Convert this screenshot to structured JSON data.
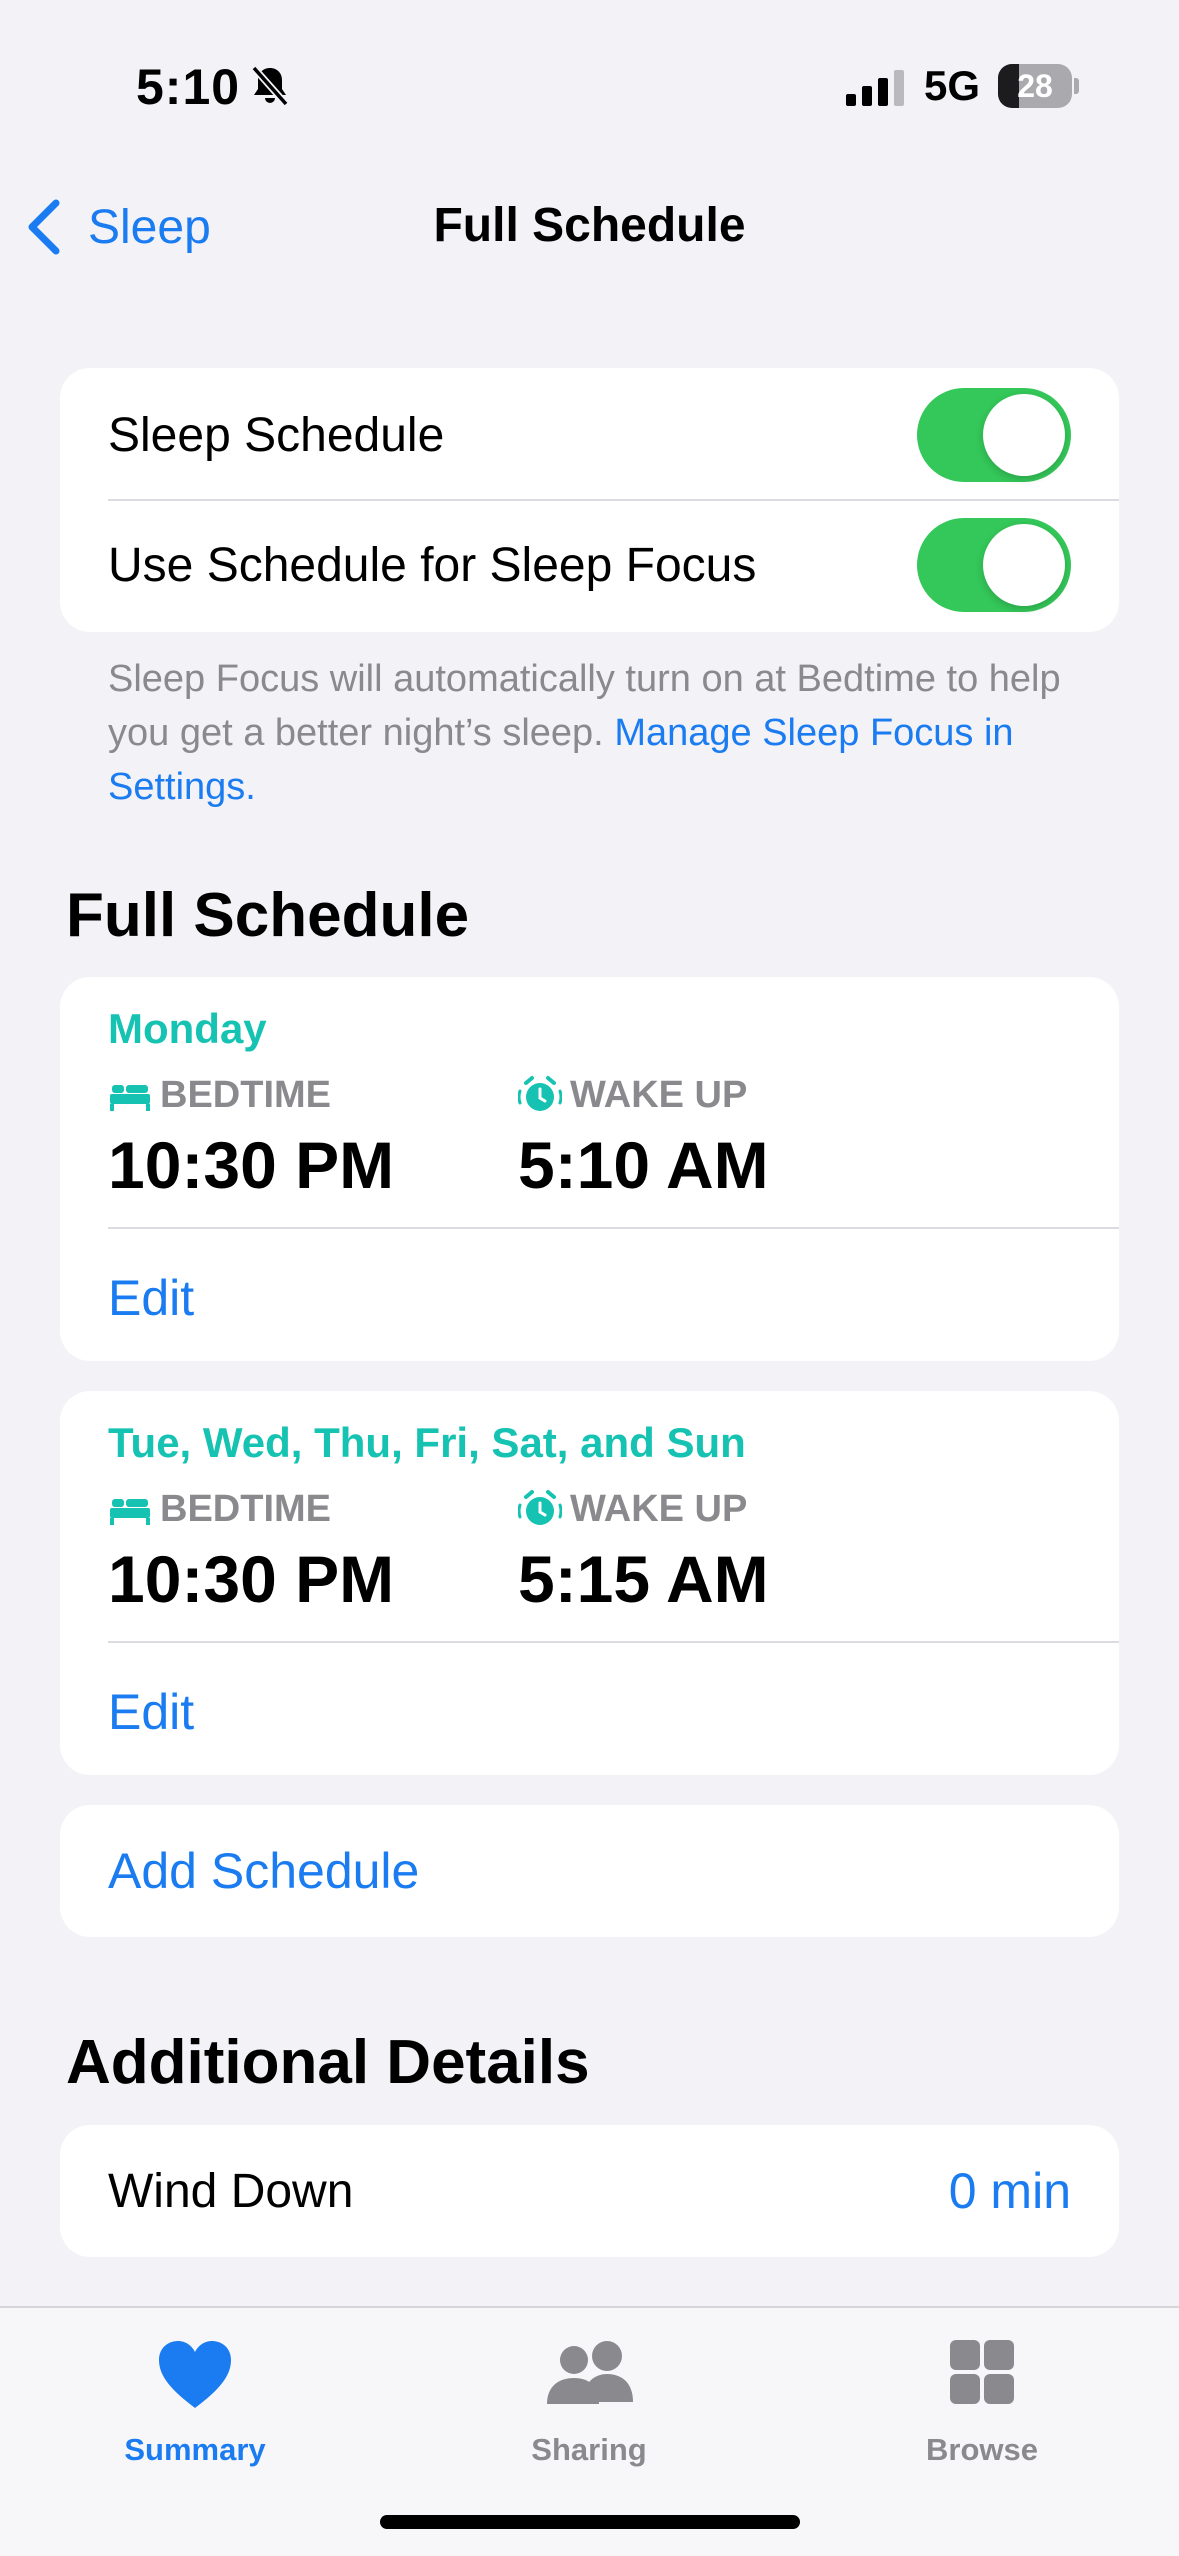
{
  "status_bar": {
    "time": "5:10",
    "network": "5G",
    "battery_level": "28",
    "battery_fraction": 0.28
  },
  "nav": {
    "back_label": "Sleep",
    "title": "Full Schedule"
  },
  "toggles": [
    {
      "label": "Sleep Schedule",
      "on": true
    },
    {
      "label": "Use Schedule for Sleep Focus",
      "on": true
    }
  ],
  "footnote": {
    "text": "Sleep Focus will automatically turn on at Bedtime to help you get a better night’s sleep.",
    "link": "Manage Sleep Focus in Settings."
  },
  "full_schedule": {
    "title": "Full Schedule",
    "schedules": [
      {
        "days": "Monday",
        "bedtime_label": "BEDTIME",
        "bedtime": "10:30 PM",
        "wake_label": "WAKE UP",
        "wake": "5:10 AM",
        "edit_label": "Edit"
      },
      {
        "days": "Tue, Wed, Thu, Fri, Sat, and Sun",
        "bedtime_label": "BEDTIME",
        "bedtime": "10:30 PM",
        "wake_label": "WAKE UP",
        "wake": "5:15 AM",
        "edit_label": "Edit"
      }
    ],
    "add_label": "Add Schedule"
  },
  "additional": {
    "title": "Additional Details",
    "wind_down_label": "Wind Down",
    "wind_down_value": "0 min"
  },
  "tabs": [
    {
      "label": "Summary",
      "active": true
    },
    {
      "label": "Sharing",
      "active": false
    },
    {
      "label": "Browse",
      "active": false
    }
  ],
  "colors": {
    "accent": "#1a7cf0",
    "toggle_on": "#34c759",
    "teal": "#16c2b1",
    "secondary": "#8a8a8e",
    "background": "#f2f2f7"
  }
}
